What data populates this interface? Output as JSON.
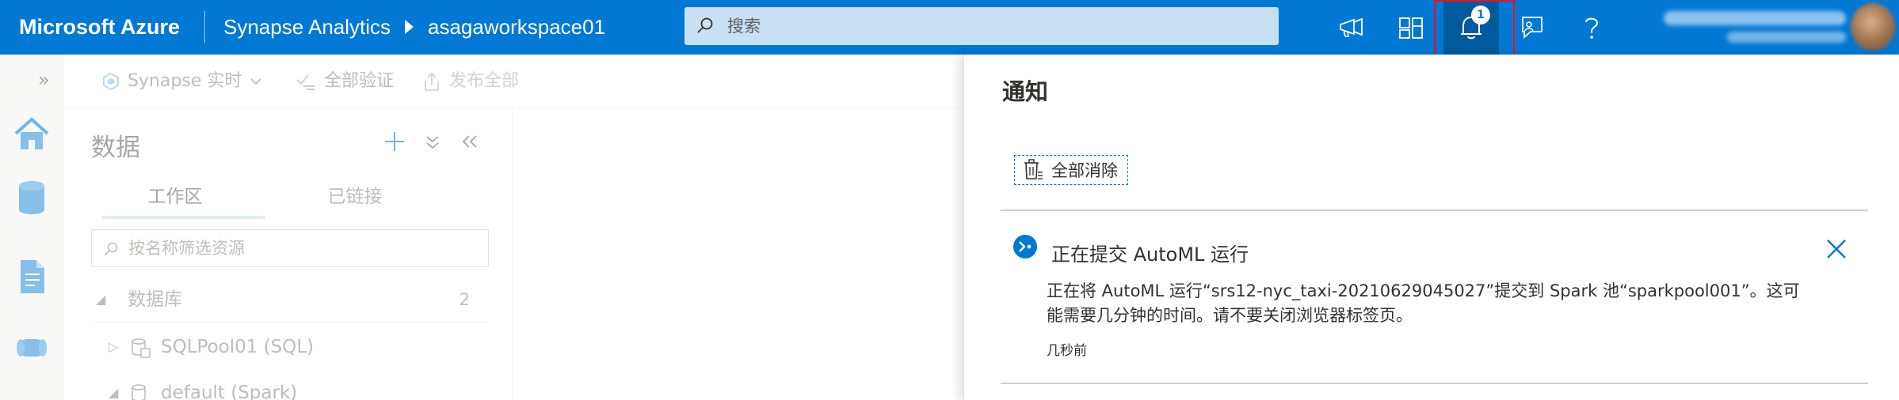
{
  "topbar": {
    "brand": "Microsoft Azure",
    "breadcrumb": [
      "Synapse Analytics",
      "asagaworkspace01"
    ],
    "search_placeholder": "搜索",
    "notification_count": "1",
    "icons": [
      "megaphone-icon",
      "portal-settings-icon",
      "bell-icon",
      "feedback-icon",
      "help-icon"
    ]
  },
  "toolbar": {
    "synapse_live": "Synapse 实时",
    "validate_all": "全部验证",
    "publish_all": "发布全部"
  },
  "data_panel": {
    "title": "数据",
    "tabs": [
      "工作区",
      "已链接"
    ],
    "filter_placeholder": "按名称筛选资源",
    "tree": [
      {
        "label": "数据库",
        "count": "2"
      },
      {
        "label": "SQLPool01 (SQL)"
      },
      {
        "label": "default (Spark)"
      }
    ]
  },
  "notifications": {
    "title": "通知",
    "clear_all": "全部消除",
    "items": [
      {
        "title": "正在提交 AutoML 运行",
        "body": "正在将 AutoML 运行“srs12-nyc_taxi-20210629045027”提交到 Spark 池“sparkpool001”。这可能需要几分钟的时间。请不要关闭浏览器标签页。",
        "time": "几秒前"
      }
    ]
  },
  "colors": {
    "accent": "#0078d4",
    "active_button": "#005a9e",
    "highlight": "#e81123"
  }
}
